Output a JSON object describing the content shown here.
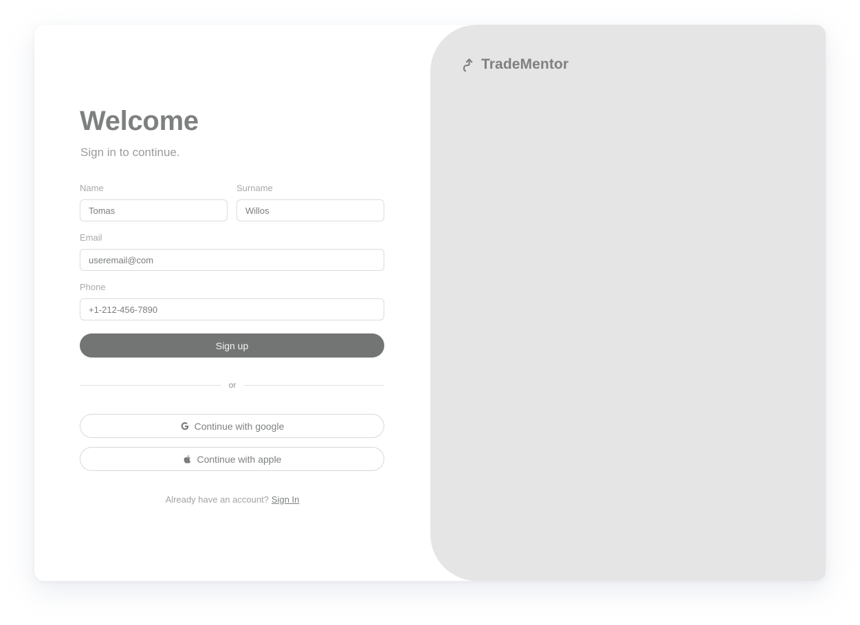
{
  "brand": {
    "name": "TradeMentor",
    "icon": "arrow-up-turn-icon"
  },
  "form": {
    "title": "Welcome",
    "subtitle": "Sign in to continue.",
    "name": {
      "label": "Name",
      "value": "Tomas"
    },
    "surname": {
      "label": "Surname",
      "value": "Willos"
    },
    "email": {
      "label": "Email",
      "value": "useremail@com"
    },
    "phone": {
      "label": "Phone",
      "value": "+1-212-456-7890"
    },
    "signup_label": "Sign up",
    "divider_text": "or",
    "google_label": "Continue with google",
    "google_icon": "google-icon",
    "apple_label": "Continue with apple",
    "apple_icon": "apple-icon"
  },
  "footer": {
    "prompt": "Already have an account?",
    "link": "Sign In"
  },
  "colors": {
    "primary_button": "#727574",
    "right_panel": "#e5e5e5",
    "title": "#7d807f"
  }
}
